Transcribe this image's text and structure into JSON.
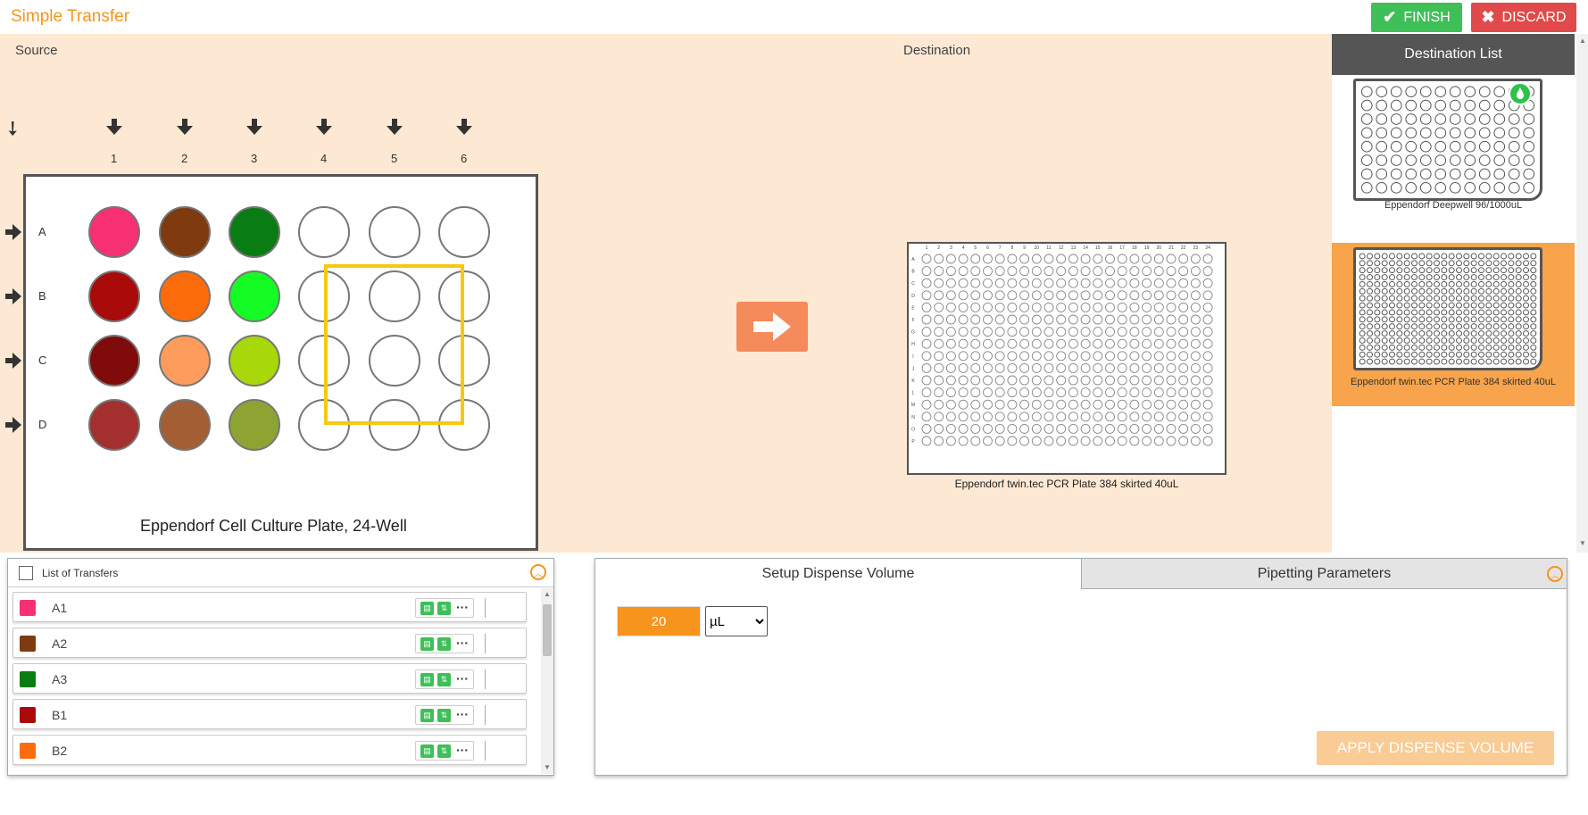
{
  "app": {
    "title": "Simple Transfer",
    "finish_label": "FINISH",
    "discard_label": "DISCARD"
  },
  "workspace": {
    "source_label": "Source",
    "destination_label": "Destination"
  },
  "source_plate": {
    "name": "Eppendorf Cell Culture Plate, 24-Well",
    "columns": [
      "1",
      "2",
      "3",
      "4",
      "5",
      "6"
    ],
    "rows": [
      "A",
      "B",
      "C",
      "D"
    ],
    "wells": [
      [
        "#f72f73",
        "#7f3a10",
        "#0a7c14",
        "",
        "",
        ""
      ],
      [
        "#a90b0b",
        "#fd6c0b",
        "#15fc24",
        "",
        "",
        ""
      ],
      [
        "#7f0b0b",
        "#fd9c5c",
        "#a8d70a",
        "",
        "",
        ""
      ],
      [
        "#a32f2f",
        "#a35e33",
        "#8da433",
        "",
        "",
        ""
      ]
    ],
    "selection": {
      "from_row": 1,
      "to_row": 3,
      "from_col": 3,
      "to_col": 5
    }
  },
  "destination_plate": {
    "name": "Eppendorf twin.tec PCR Plate 384 skirted 40uL",
    "rows": [
      "A",
      "B",
      "C",
      "D",
      "E",
      "F",
      "G",
      "H",
      "I",
      "J",
      "K",
      "L",
      "M",
      "N",
      "O",
      "P"
    ],
    "columns": [
      "1",
      "2",
      "3",
      "4",
      "5",
      "6",
      "7",
      "8",
      "9",
      "10",
      "11",
      "12",
      "13",
      "14",
      "15",
      "16",
      "17",
      "18",
      "19",
      "20",
      "21",
      "22",
      "23",
      "24"
    ]
  },
  "destination_list": {
    "header": "Destination List",
    "items": [
      {
        "label": "Eppendorf Deepwell 96/1000uL",
        "rows": 8,
        "cols": 12,
        "active": false
      },
      {
        "label": "Eppendorf twin.tec PCR Plate 384 skirted 40uL",
        "rows": 16,
        "cols": 24,
        "active": true
      }
    ]
  },
  "transfers": {
    "title": "List of Transfers",
    "items": [
      {
        "label": "A1",
        "color": "#f72f73"
      },
      {
        "label": "A2",
        "color": "#7f3a10"
      },
      {
        "label": "A3",
        "color": "#0a7c14"
      },
      {
        "label": "B1",
        "color": "#a90b0b"
      },
      {
        "label": "B2",
        "color": "#fd6c0b"
      }
    ]
  },
  "dispense": {
    "tab_setup": "Setup Dispense Volume",
    "tab_pipetting": "Pipetting Parameters",
    "volume": "20",
    "unit": "µL",
    "apply_label": "APPLY DISPENSE VOLUME"
  },
  "colors": {
    "accent": "#f7941d",
    "finish": "#3fbf58",
    "discard": "#e14a4a",
    "workspace_bg": "#fce8d3",
    "selection": "#f6c911",
    "transfer_arrow": "#f58a5b"
  }
}
